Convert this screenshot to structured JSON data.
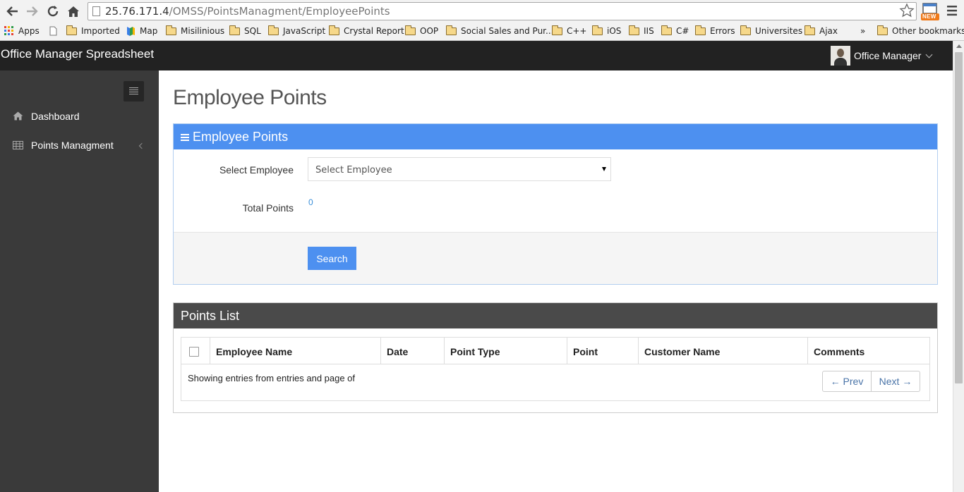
{
  "browser": {
    "url_host": "25.76.171.4",
    "url_path": "/OMSS/PointsManagment/EmployeePoints",
    "ext_badge": "NEW",
    "bookmarks": [
      "Apps",
      "Imported",
      "Map",
      "Misilinious",
      "SQL",
      "JavaScript",
      "Crystal Report",
      "OOP",
      "Social Sales and Pur...",
      "C++",
      "iOS",
      "IIS",
      "C#",
      "Errors",
      "Universites",
      "Ajax"
    ],
    "more_chevron": "»",
    "other_bookmarks": "Other bookmarks"
  },
  "header": {
    "brand": "Office Manager Spreadsheet",
    "user_name": "Office Manager"
  },
  "sidebar": {
    "items": [
      {
        "label": "Dashboard",
        "icon": "home-icon"
      },
      {
        "label": "Points Managment",
        "icon": "table-icon"
      }
    ]
  },
  "main": {
    "page_title": "Employee Points",
    "form_panel": {
      "title": "Employee Points",
      "select_label": "Select Employee",
      "select_value": "Select Employee",
      "total_label": "Total Points",
      "total_value": "0",
      "search_button": "Search"
    },
    "list_panel": {
      "title": "Points List",
      "columns": [
        "Employee Name",
        "Date",
        "Point Type",
        "Point",
        "Customer Name",
        "Comments"
      ],
      "info": "Showing entries from entries and page of",
      "prev": "← Prev",
      "next": "Next →"
    }
  },
  "colors": {
    "accent": "#4d90f0",
    "topbar": "#222222",
    "sidebar": "#3a3a3a",
    "list_header": "#4a4a4a"
  }
}
